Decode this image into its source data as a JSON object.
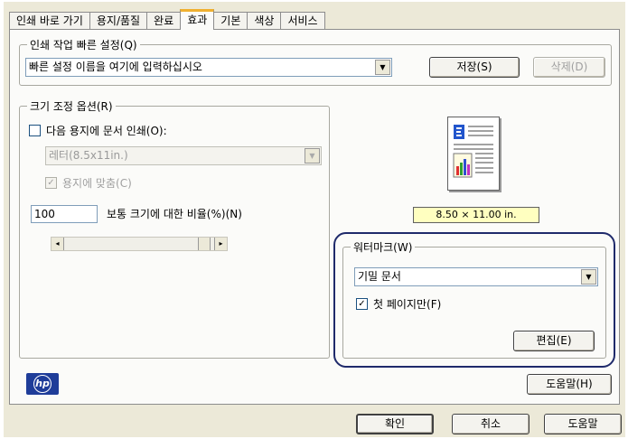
{
  "tabs": [
    "인쇄 바로 가기",
    "용지/품질",
    "완료",
    "효과",
    "기본",
    "색상",
    "서비스"
  ],
  "active_tab_index": 3,
  "quick_settings": {
    "legend": "인쇄 작업 빠른 설정(Q)",
    "combo_value": "빠른 설정 이름을 여기에 입력하십시오",
    "save_label": "저장(S)",
    "delete_label": "삭제(D)"
  },
  "resize": {
    "legend": "크기 조정 옵션(R)",
    "print_on_label": "다음 용지에 문서 인쇄(O):",
    "print_on_checked": false,
    "paper_value": "레터(8.5x11in.)",
    "fit_label": "용지에 맞춤(C)",
    "fit_checked": true,
    "percent_value": "100",
    "percent_label": "보통 크기에 대한 비율(%)(N)",
    "scroll_left": "◂",
    "scroll_right": "▸"
  },
  "preview": {
    "size_label": "8.50 × 11.00 in."
  },
  "watermark": {
    "legend": "워터마크(W)",
    "combo_value": "기밀 문서",
    "first_page_label": "첫 페이지만(F)",
    "first_page_checked": true,
    "edit_label": "편집(E)"
  },
  "logo_text": "hp",
  "help_label": "도움말(H)",
  "footer": {
    "ok_label": "확인",
    "cancel_label": "취소",
    "help_label": "도움말"
  },
  "icons": {
    "combo_arrow": "▼",
    "check_mark": "✓"
  },
  "colors": {
    "highlight_ring": "#1f2a6b",
    "size_badge": "#ffffc0",
    "hp_logo": "#1f3d99"
  }
}
